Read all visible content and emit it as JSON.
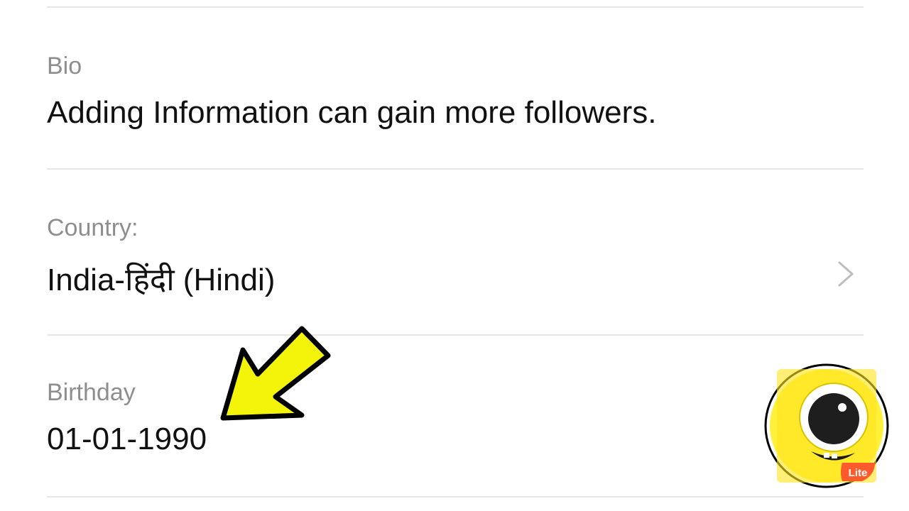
{
  "profile": {
    "bio": {
      "label": "Bio",
      "value": "Adding Information can gain more followers."
    },
    "country": {
      "label": "Country:",
      "value": "India-हिंदी (Hindi)",
      "chevron_icon": "chevron-right-icon"
    },
    "birthday": {
      "label": "Birthday",
      "value": "01-01-1990"
    }
  },
  "overlay": {
    "arrow_icon": "arrow-pointer-icon",
    "arrow_color": "#f4f40a",
    "logo_icon": "app-logo-icon",
    "logo_color": "#fff03a",
    "logo_badge": "Lite",
    "badge_color": "#ff5a2b"
  }
}
